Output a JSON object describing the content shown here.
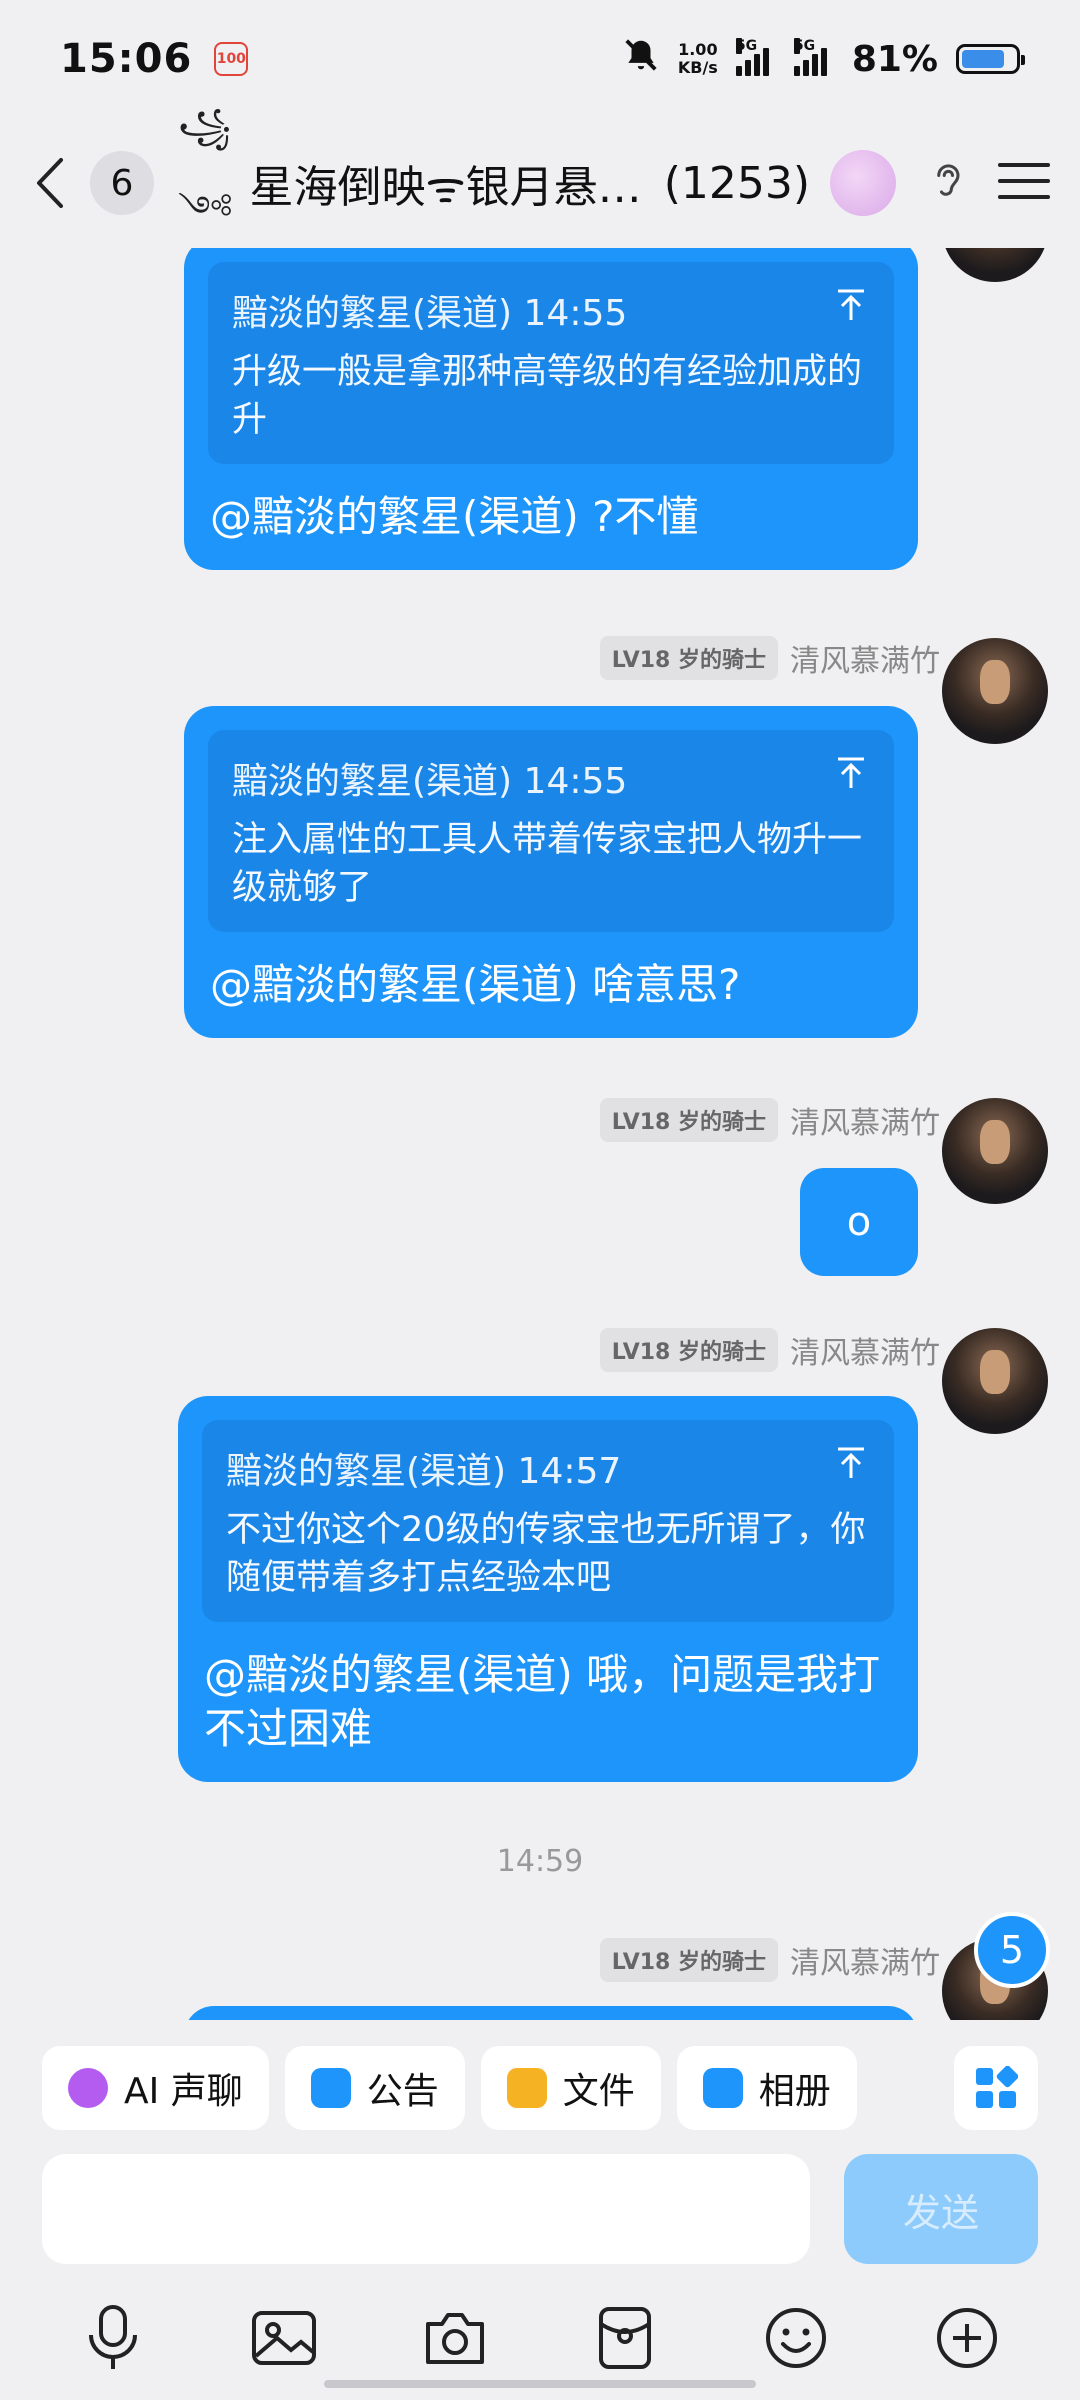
{
  "status_bar": {
    "time": "15:06",
    "app_badge": "100",
    "net_speed_value": "1.00",
    "net_speed_unit": "KB/s",
    "sim1": "5G",
    "sim2": "5G",
    "battery": "81%",
    "battery_level": 0.81
  },
  "header": {
    "unread": "6",
    "title_deco": "꧁༺",
    "title": "星海倒映ᯤ银月悬…",
    "member_count": "(1253)"
  },
  "messages": [
    {
      "quote_author_time": "黯淡的繁星(渠道) 14:55",
      "quote_text": "升级一般是拿那种高等级的有经验加成的升",
      "reply": "@黯淡的繁星(渠道) ?不懂"
    },
    {
      "level": "LV18 岁的骑士",
      "sender": "清风慕满竹",
      "quote_author_time": "黯淡的繁星(渠道) 14:55",
      "quote_text": "注入属性的工具人带着传家宝把人物升一级就够了",
      "reply": "@黯淡的繁星(渠道) 啥意思?"
    },
    {
      "level": "LV18 岁的骑士",
      "sender": "清风慕满竹",
      "text": "o"
    },
    {
      "level": "LV18 岁的骑士",
      "sender": "清风慕满竹",
      "quote_author_time": "黯淡的繁星(渠道) 14:57",
      "quote_text": "不过你这个20级的传家宝也无所谓了，你随便带着多打点经验本吧",
      "reply": "@黯淡的繁星(渠道) 哦，问题是我打不过困难"
    },
    {
      "time_separator": "14:59",
      "level": "LV18 岁的骑士",
      "sender": "清风慕满竹"
    }
  ],
  "new_message_count": "5",
  "quick_actions": [
    {
      "label": "AI 声聊",
      "icon": "ai-voice-icon",
      "color": "#b45cf0"
    },
    {
      "label": "公告",
      "icon": "announcement-icon",
      "color": "#1e95fa"
    },
    {
      "label": "文件",
      "icon": "folder-icon",
      "color": "#f5b323"
    },
    {
      "label": "相册",
      "icon": "album-icon",
      "color": "#1e95fa"
    }
  ],
  "input": {
    "value": "",
    "send_label": "发送"
  },
  "toolbar": [
    "microphone-icon",
    "image-icon",
    "camera-icon",
    "red-packet-icon",
    "emoji-icon",
    "plus-icon"
  ]
}
